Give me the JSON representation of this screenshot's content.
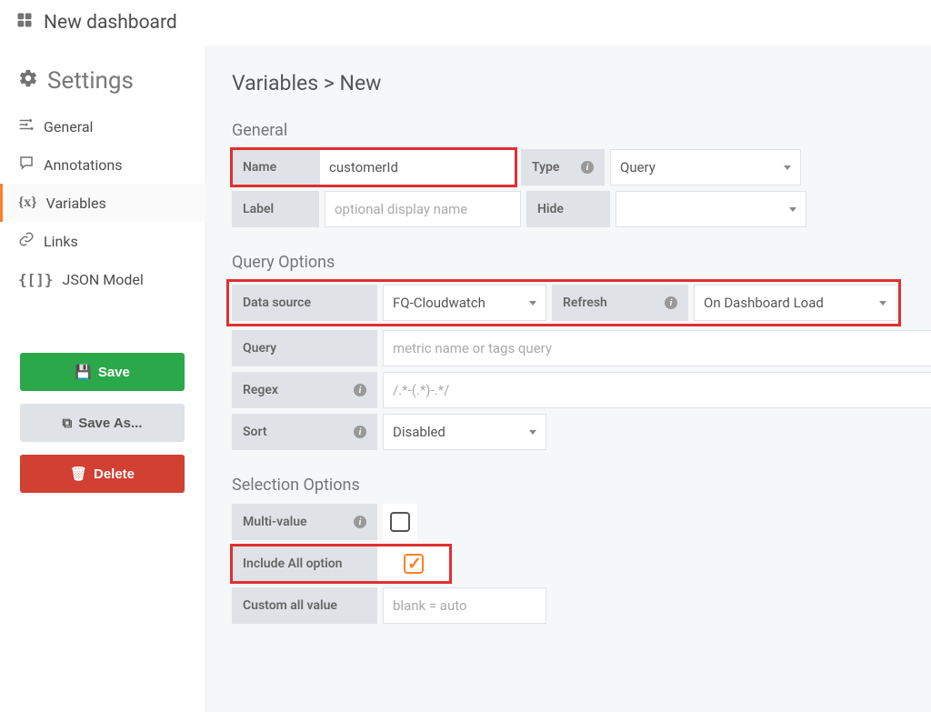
{
  "topbar": {
    "title": "New dashboard"
  },
  "sidebar": {
    "title": "Settings",
    "nav": {
      "general": "General",
      "annotations": "Annotations",
      "variables": "Variables",
      "links": "Links",
      "jsonmodel": "JSON Model"
    },
    "buttons": {
      "save": "Save",
      "saveas": "Save As...",
      "delete": "Delete"
    }
  },
  "page": {
    "title": "Variables > New"
  },
  "general": {
    "title": "General",
    "name_label": "Name",
    "name_value": "customerId",
    "type_label": "Type",
    "type_value": "Query",
    "label_label": "Label",
    "label_placeholder": "optional display name",
    "hide_label": "Hide"
  },
  "queryOptions": {
    "title": "Query Options",
    "datasource_label": "Data source",
    "datasource_value": "FQ-Cloudwatch",
    "refresh_label": "Refresh",
    "refresh_value": "On Dashboard Load",
    "query_label": "Query",
    "query_placeholder": "metric name or tags query",
    "regex_label": "Regex",
    "regex_placeholder": "/.*-(.*)-.*/",
    "sort_label": "Sort",
    "sort_value": "Disabled"
  },
  "selectionOptions": {
    "title": "Selection Options",
    "multi_label": "Multi-value",
    "includeall_label": "Include All option",
    "customall_label": "Custom all value",
    "customall_placeholder": "blank = auto"
  }
}
